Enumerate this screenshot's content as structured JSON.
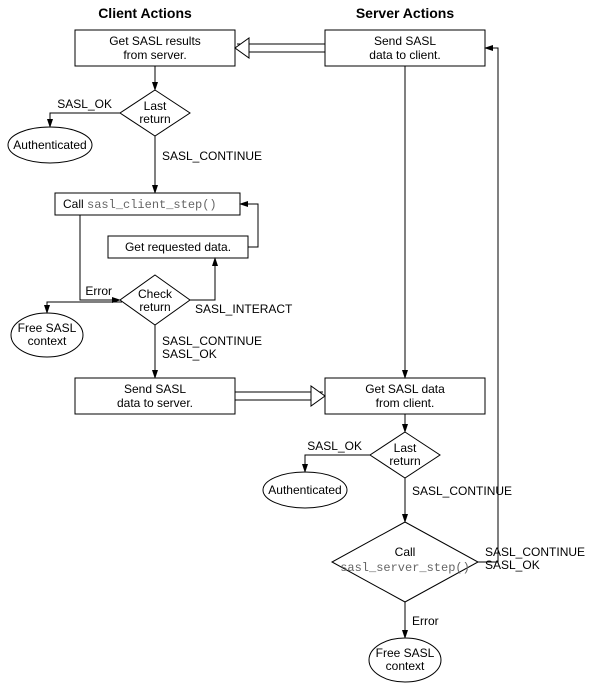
{
  "headers": {
    "client": "Client Actions",
    "server": "Server Actions"
  },
  "nodes": {
    "client_get_results_l1": "Get SASL results",
    "client_get_results_l2": "from server.",
    "server_send_data_l1": "Send SASL",
    "server_send_data_l2": "data to client.",
    "last_return_1_l1": "Last",
    "last_return_1_l2": "return",
    "authenticated_1": "Authenticated",
    "call_client_step_prefix": "Call ",
    "call_client_step_fn": "sasl_client_step()",
    "get_requested": "Get requested data.",
    "check_return_l1": "Check",
    "check_return_l2": "return",
    "free_ctx_1_l1": "Free SASL",
    "free_ctx_1_l2": "context",
    "client_send_data_l1": "Send SASL",
    "client_send_data_l2": "data to server.",
    "server_get_data_l1": "Get SASL data",
    "server_get_data_l2": "from client.",
    "last_return_2_l1": "Last",
    "last_return_2_l2": "return",
    "authenticated_2": "Authenticated",
    "call_server_step_prefix": "Call",
    "call_server_step_fn": "sasl_server_step()",
    "free_ctx_2_l1": "Free SASL",
    "free_ctx_2_l2": "context"
  },
  "labels": {
    "sasl_ok_1": "SASL_OK",
    "sasl_continue_1": "SASL_CONTINUE",
    "error_1": "Error",
    "sasl_interact": "SASL_INTERACT",
    "sasl_cont_ok_1a": "SASL_CONTINUE",
    "sasl_cont_ok_1b": "SASL_OK",
    "sasl_ok_2": "SASL_OK",
    "sasl_continue_2": "SASL_CONTINUE",
    "sasl_cont_ok_2a": "SASL_CONTINUE",
    "sasl_cont_ok_2b": "SASL_OK",
    "error_2": "Error"
  }
}
